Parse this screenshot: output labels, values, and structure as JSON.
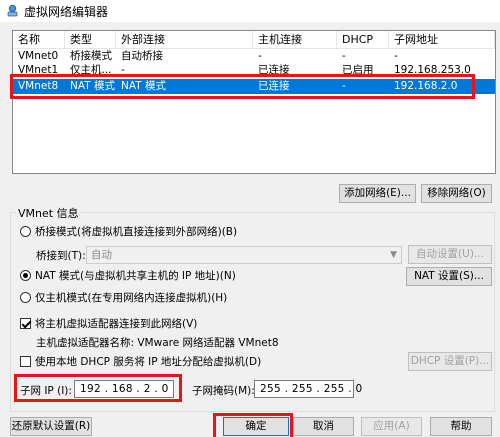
{
  "window": {
    "title": "虚拟网络编辑器",
    "icon": "vmware-app-icon"
  },
  "table": {
    "columns": [
      "名称",
      "类型",
      "外部连接",
      "主机连接",
      "DHCP",
      "子网地址"
    ],
    "rows": [
      {
        "name": "VMnet0",
        "type": "桥接模式",
        "external": "自动桥接",
        "host": "-",
        "dhcp": "-",
        "subnet": "-"
      },
      {
        "name": "VMnet1",
        "type": "仅主机...",
        "external": "-",
        "host": "已连接",
        "dhcp": "已启用",
        "subnet": "192.168.253.0"
      },
      {
        "name": "VMnet8",
        "type": "NAT 模式",
        "external": "NAT 模式",
        "host": "已连接",
        "dhcp": "-",
        "subnet": "192.168.2.0"
      }
    ],
    "selected_row": "VMnet8"
  },
  "list_buttons": {
    "add": "添加网络(E)...",
    "remove": "移除网络(O)"
  },
  "vmnet_info": {
    "group_label": "VMnet 信息",
    "bridge_mode": "桥接模式(将虚拟机直接连接到外部网络)(B)",
    "bridge_to_label": "桥接到(T):",
    "bridge_to_value": "自动",
    "auto_settings": "自动设置(U)...",
    "nat_mode": "NAT 模式(与虚拟机共享主机的 IP 地址)(N)",
    "nat_settings": "NAT 设置(S)...",
    "host_only": "仅主机模式(在专用网络内连接虚拟机)(H)",
    "connect_adapter": "将主机虚拟适配器连接到此网络(V)",
    "adapter_name": "主机虚拟适配器名称: VMware 网络适配器 VMnet8",
    "use_dhcp": "使用本地 DHCP 服务将 IP 地址分配给虚拟机(D)",
    "dhcp_settings": "DHCP 设置(P)...",
    "subnet_ip_label": "子网 IP (I):",
    "subnet_ip_value": "192 . 168 .  2  .  0",
    "subnet_mask_label": "子网掩码(M):",
    "subnet_mask_value": "255 . 255 . 255 .  0",
    "mode_selected": "nat",
    "connect_adapter_checked": true,
    "use_dhcp_checked": false
  },
  "footer": {
    "restore": "还原默认设置(R)",
    "ok": "确定",
    "cancel": "取消",
    "apply": "应用(A)",
    "help": "帮助"
  },
  "colors": {
    "selection": "#0078d7",
    "highlight": "#e8141a"
  }
}
